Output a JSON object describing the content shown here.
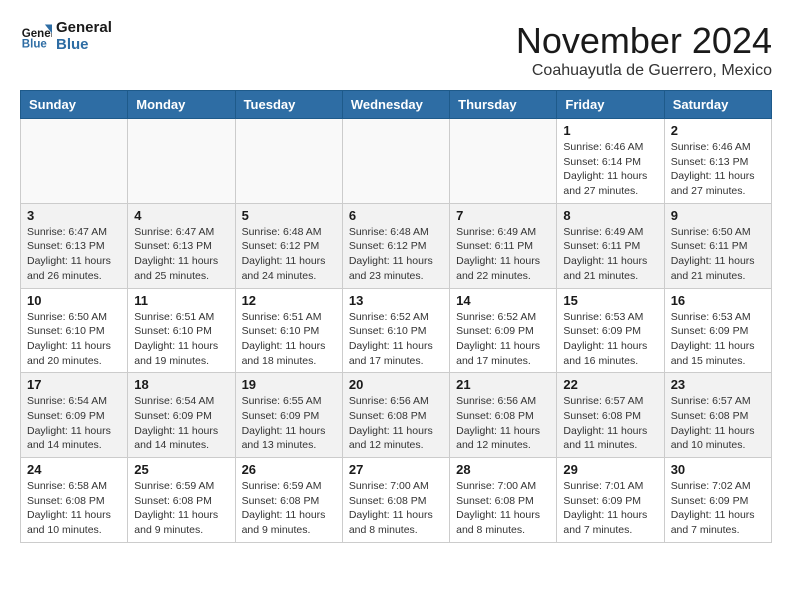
{
  "header": {
    "logo_line1": "General",
    "logo_line2": "Blue",
    "month_title": "November 2024",
    "location": "Coahuayutla de Guerrero, Mexico"
  },
  "weekdays": [
    "Sunday",
    "Monday",
    "Tuesday",
    "Wednesday",
    "Thursday",
    "Friday",
    "Saturday"
  ],
  "weeks": [
    [
      {
        "day": "",
        "info": ""
      },
      {
        "day": "",
        "info": ""
      },
      {
        "day": "",
        "info": ""
      },
      {
        "day": "",
        "info": ""
      },
      {
        "day": "",
        "info": ""
      },
      {
        "day": "1",
        "info": "Sunrise: 6:46 AM\nSunset: 6:14 PM\nDaylight: 11 hours and 27 minutes."
      },
      {
        "day": "2",
        "info": "Sunrise: 6:46 AM\nSunset: 6:13 PM\nDaylight: 11 hours and 27 minutes."
      }
    ],
    [
      {
        "day": "3",
        "info": "Sunrise: 6:47 AM\nSunset: 6:13 PM\nDaylight: 11 hours and 26 minutes."
      },
      {
        "day": "4",
        "info": "Sunrise: 6:47 AM\nSunset: 6:13 PM\nDaylight: 11 hours and 25 minutes."
      },
      {
        "day": "5",
        "info": "Sunrise: 6:48 AM\nSunset: 6:12 PM\nDaylight: 11 hours and 24 minutes."
      },
      {
        "day": "6",
        "info": "Sunrise: 6:48 AM\nSunset: 6:12 PM\nDaylight: 11 hours and 23 minutes."
      },
      {
        "day": "7",
        "info": "Sunrise: 6:49 AM\nSunset: 6:11 PM\nDaylight: 11 hours and 22 minutes."
      },
      {
        "day": "8",
        "info": "Sunrise: 6:49 AM\nSunset: 6:11 PM\nDaylight: 11 hours and 21 minutes."
      },
      {
        "day": "9",
        "info": "Sunrise: 6:50 AM\nSunset: 6:11 PM\nDaylight: 11 hours and 21 minutes."
      }
    ],
    [
      {
        "day": "10",
        "info": "Sunrise: 6:50 AM\nSunset: 6:10 PM\nDaylight: 11 hours and 20 minutes."
      },
      {
        "day": "11",
        "info": "Sunrise: 6:51 AM\nSunset: 6:10 PM\nDaylight: 11 hours and 19 minutes."
      },
      {
        "day": "12",
        "info": "Sunrise: 6:51 AM\nSunset: 6:10 PM\nDaylight: 11 hours and 18 minutes."
      },
      {
        "day": "13",
        "info": "Sunrise: 6:52 AM\nSunset: 6:10 PM\nDaylight: 11 hours and 17 minutes."
      },
      {
        "day": "14",
        "info": "Sunrise: 6:52 AM\nSunset: 6:09 PM\nDaylight: 11 hours and 17 minutes."
      },
      {
        "day": "15",
        "info": "Sunrise: 6:53 AM\nSunset: 6:09 PM\nDaylight: 11 hours and 16 minutes."
      },
      {
        "day": "16",
        "info": "Sunrise: 6:53 AM\nSunset: 6:09 PM\nDaylight: 11 hours and 15 minutes."
      }
    ],
    [
      {
        "day": "17",
        "info": "Sunrise: 6:54 AM\nSunset: 6:09 PM\nDaylight: 11 hours and 14 minutes."
      },
      {
        "day": "18",
        "info": "Sunrise: 6:54 AM\nSunset: 6:09 PM\nDaylight: 11 hours and 14 minutes."
      },
      {
        "day": "19",
        "info": "Sunrise: 6:55 AM\nSunset: 6:09 PM\nDaylight: 11 hours and 13 minutes."
      },
      {
        "day": "20",
        "info": "Sunrise: 6:56 AM\nSunset: 6:08 PM\nDaylight: 11 hours and 12 minutes."
      },
      {
        "day": "21",
        "info": "Sunrise: 6:56 AM\nSunset: 6:08 PM\nDaylight: 11 hours and 12 minutes."
      },
      {
        "day": "22",
        "info": "Sunrise: 6:57 AM\nSunset: 6:08 PM\nDaylight: 11 hours and 11 minutes."
      },
      {
        "day": "23",
        "info": "Sunrise: 6:57 AM\nSunset: 6:08 PM\nDaylight: 11 hours and 10 minutes."
      }
    ],
    [
      {
        "day": "24",
        "info": "Sunrise: 6:58 AM\nSunset: 6:08 PM\nDaylight: 11 hours and 10 minutes."
      },
      {
        "day": "25",
        "info": "Sunrise: 6:59 AM\nSunset: 6:08 PM\nDaylight: 11 hours and 9 minutes."
      },
      {
        "day": "26",
        "info": "Sunrise: 6:59 AM\nSunset: 6:08 PM\nDaylight: 11 hours and 9 minutes."
      },
      {
        "day": "27",
        "info": "Sunrise: 7:00 AM\nSunset: 6:08 PM\nDaylight: 11 hours and 8 minutes."
      },
      {
        "day": "28",
        "info": "Sunrise: 7:00 AM\nSunset: 6:08 PM\nDaylight: 11 hours and 8 minutes."
      },
      {
        "day": "29",
        "info": "Sunrise: 7:01 AM\nSunset: 6:09 PM\nDaylight: 11 hours and 7 minutes."
      },
      {
        "day": "30",
        "info": "Sunrise: 7:02 AM\nSunset: 6:09 PM\nDaylight: 11 hours and 7 minutes."
      }
    ]
  ]
}
